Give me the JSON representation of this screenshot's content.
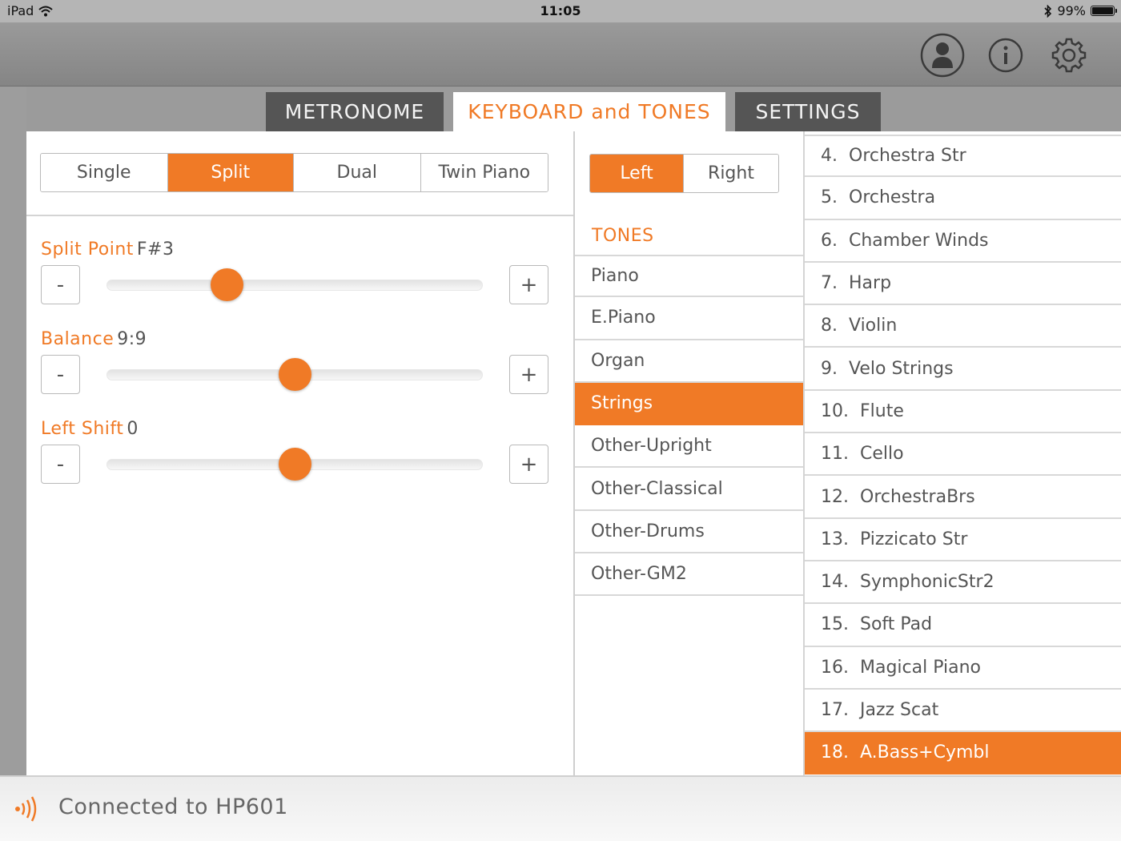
{
  "status": {
    "device": "iPad",
    "time": "11:05",
    "battery": "99%",
    "battery_level": 0.99
  },
  "topbar": {
    "icons": [
      "user-icon",
      "info-icon",
      "gear-icon"
    ]
  },
  "tabs": [
    {
      "label": "METRONOME",
      "active": false
    },
    {
      "label": "KEYBOARD and TONES",
      "active": true
    },
    {
      "label": "SETTINGS",
      "active": false
    }
  ],
  "mode": {
    "options": [
      "Single",
      "Split",
      "Dual",
      "Twin Piano"
    ],
    "selected": "Split"
  },
  "params": {
    "split_point": {
      "label": "Split Point",
      "value": "F#3",
      "position": 0.32
    },
    "balance": {
      "label": "Balance",
      "value": "9:9",
      "position": 0.5
    },
    "left_shift": {
      "label": "Left Shift",
      "value": "0",
      "position": 0.5
    },
    "minus": "-",
    "plus": "+"
  },
  "side": {
    "options": [
      "Left",
      "Right"
    ],
    "selected": "Left"
  },
  "tones": {
    "title": "TONES",
    "items": [
      "Piano",
      "E.Piano",
      "Organ",
      "Strings",
      "Other-Upright",
      "Other-Classical",
      "Other-Drums",
      "Other-GM2"
    ],
    "selected": "Strings"
  },
  "variations": {
    "items": [
      {
        "num": "4.",
        "name": "Orchestra Str"
      },
      {
        "num": "5.",
        "name": "Orchestra"
      },
      {
        "num": "6.",
        "name": "Chamber Winds"
      },
      {
        "num": "7.",
        "name": "Harp"
      },
      {
        "num": "8.",
        "name": "Violin"
      },
      {
        "num": "9.",
        "name": "Velo Strings"
      },
      {
        "num": "10.",
        "name": "Flute"
      },
      {
        "num": "11.",
        "name": "Cello"
      },
      {
        "num": "12.",
        "name": "OrchestraBrs"
      },
      {
        "num": "13.",
        "name": "Pizzicato Str"
      },
      {
        "num": "14.",
        "name": "SymphonicStr2"
      },
      {
        "num": "15.",
        "name": "Soft Pad"
      },
      {
        "num": "16.",
        "name": "Magical Piano"
      },
      {
        "num": "17.",
        "name": "Jazz Scat"
      },
      {
        "num": "18.",
        "name": "A.Bass+Cymbl"
      }
    ],
    "selected": "A.Bass+Cymbl"
  },
  "footer": {
    "text": "Connected to HP601"
  },
  "colors": {
    "accent": "#f07a26",
    "dark_tab": "#555555"
  }
}
